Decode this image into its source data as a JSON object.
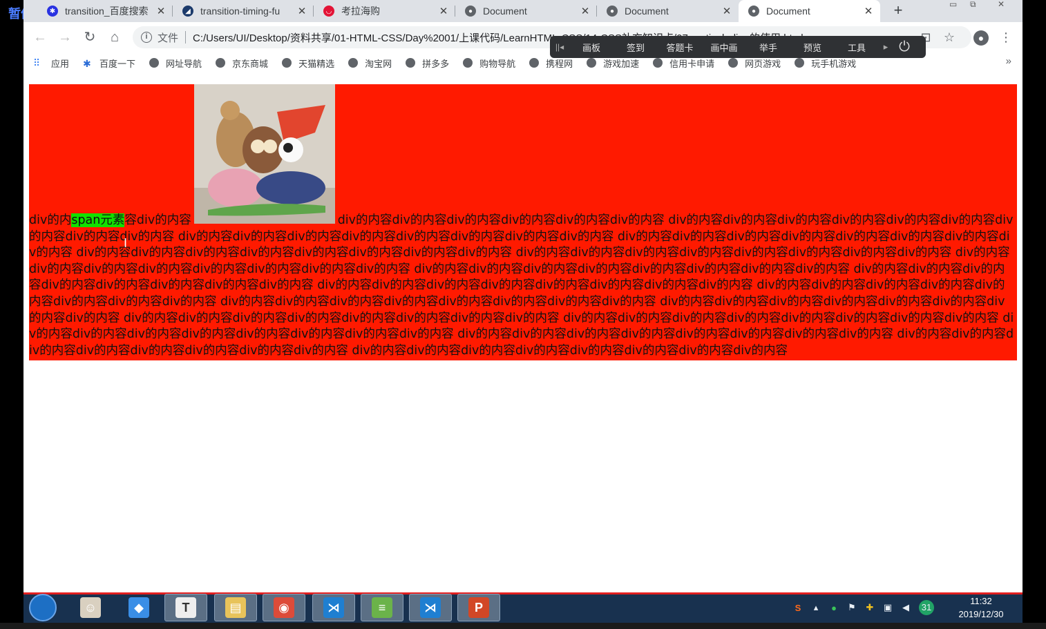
{
  "overlay": {
    "pause_label": "暂停"
  },
  "browser": {
    "tabs": [
      {
        "title": "transition_百度搜索",
        "favicon": "baidu-paw-icon",
        "color": "#2932e1"
      },
      {
        "title": "transition-timing-fu",
        "favicon": "mdn-icon",
        "color": "#1b3a6b"
      },
      {
        "title": "考拉海购",
        "favicon": "kaola-icon",
        "color": "#e31436"
      },
      {
        "title": "Document",
        "favicon": "globe-icon",
        "color": "#5f6368"
      },
      {
        "title": "Document",
        "favicon": "globe-icon",
        "color": "#5f6368"
      },
      {
        "title": "Document",
        "favicon": "globe-icon",
        "color": "#5f6368",
        "active": true
      }
    ],
    "new_tab": "+",
    "address": {
      "scheme_label": "文件",
      "url": "C:/Users/UI/Desktop/资料共享/01-HTML-CSS/Day%2001/上课代码/LearnHTML-CSS/14-CSS补充知识点/07-vertical-align的使用.html"
    },
    "bookmarks": [
      {
        "label": "应用",
        "icon": "apps-grid-icon"
      },
      {
        "label": "百度一下",
        "icon": "baidu-paw-icon"
      },
      {
        "label": "网址导航",
        "icon": "globe-icon"
      },
      {
        "label": "京东商城",
        "icon": "globe-icon"
      },
      {
        "label": "天猫精选",
        "icon": "globe-icon"
      },
      {
        "label": "淘宝网",
        "icon": "globe-icon"
      },
      {
        "label": "拼多多",
        "icon": "globe-icon"
      },
      {
        "label": "购物导航",
        "icon": "globe-icon"
      },
      {
        "label": "携程网",
        "icon": "globe-icon"
      },
      {
        "label": "游戏加速",
        "icon": "globe-icon"
      },
      {
        "label": "信用卡申请",
        "icon": "globe-icon"
      },
      {
        "label": "网页游戏",
        "icon": "globe-icon"
      },
      {
        "label": "玩手机游戏",
        "icon": "globe-icon"
      }
    ],
    "more_bookmarks": "»"
  },
  "classroom_toolbar": {
    "items": [
      "画板",
      "签到",
      "答题卡",
      "画中画",
      "举手",
      "预览",
      "工具"
    ]
  },
  "page": {
    "bg_color": "#ff1a00",
    "span_bg_color": "#12e000",
    "text_before_span": "div的内",
    "span_text": "span元素",
    "text_after_span": "容div的内容",
    "image_alt": "stuffed toys photo",
    "text_after_image": "div的内容div的内容div的内容div的内容div的内容div的内容 div的内容div的内容div的内容div的内容div的内容div的内容div的内容div的内容div的内容 div的内容div的内容div的内容div的内容div的内容div的内容div的内容div的内容 div的内容div的内容div的内容div的内容div的内容div的内容div的内容div的内容 div的内容div的内容div的内容div的内容div的内容div的内容div的内容div的内容 div的内容div的内容div的内容div的内容div的内容div的内容div的内容div的内容 div的内容div的内容div的内容div的内容div的内容div的内容div的内容div的内容 div的内容div的内容div的内容div的内容div的内容div的内容div的内容div的内容 div的内容div的内容div的内容div的内容div的内容div的内容div的内容div的内容 div的内容div的内容div的内容div的内容div的内容div的内容div的内容div的内容 div的内容div的内容div的内容div的内容div的内容div的内容div的内容div的内容 div的内容div的内容div的内容div的内容div的内容div的内容div的内容div的内容 div的内容div的内容div的内容div的内容div的内容div的内容div的内容div的内容 div的内容div的内容div的内容div的内容div的内容div的内容div的内容div的内容 div的内容div的内容div的内容div的内容div的内容div的内容div的内容div的内容 div的内容div的内容div的内容div的内容div的内容div的内容div的内容div的内容 div的内容div的内容div的内容div的内容div的内容div的内容div的内容div的内容 div的内容div的内容div的内容div的内容div的内容div的内容div的内容div的内容 div的内容div的内容div的内容div的内容div的内容div的内容div的内容div的内容"
  },
  "taskbar": {
    "apps": [
      {
        "name": "qq-avatar-icon",
        "label": "☺",
        "color": "#d9d0c0"
      },
      {
        "name": "feishu-icon",
        "label": "◆",
        "color": "#3a8ee6"
      },
      {
        "name": "typora-icon",
        "label": "T",
        "color": "#eeeeee"
      },
      {
        "name": "explorer-icon",
        "label": "▤",
        "color": "#e8c35a"
      },
      {
        "name": "chrome-icon",
        "label": "◉",
        "color": "#dd4b39"
      },
      {
        "name": "vscode-icon",
        "label": "⋊",
        "color": "#1f7fd1"
      },
      {
        "name": "notepad-icon",
        "label": "≡",
        "color": "#6bb34a"
      },
      {
        "name": "vscode-icon",
        "label": "⋊",
        "color": "#1f7fd1"
      },
      {
        "name": "powerpoint-icon",
        "label": "P",
        "color": "#d24726"
      }
    ],
    "clock_time": "11:32",
    "clock_date": "2019/12/30",
    "tray_badge": "31"
  }
}
